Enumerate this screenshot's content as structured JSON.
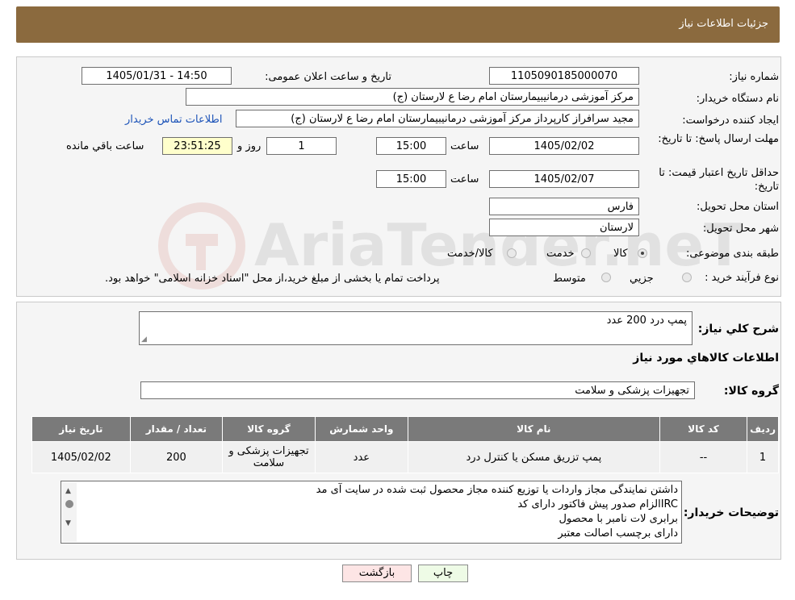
{
  "header": {
    "title": "جزئیات اطلاعات نیاز"
  },
  "labels": {
    "need_number": "شماره نیاز:",
    "announce_datetime": "تاریخ و ساعت اعلان عمومی:",
    "buyer_org": "نام دستگاه خریدار:",
    "creator": "ایجاد کننده درخواست:",
    "reply_deadline": "مهلت ارسال پاسخ: تا تاریخ:",
    "time": "ساعت",
    "day_and": "روز و",
    "remaining": "ساعت باقي مانده",
    "price_validity": "حداقل تاریخ اعتبار قیمت: تا تاریخ:",
    "province": "استان محل تحویل:",
    "city": "شهر محل تحویل:",
    "category": "طبقه بندی موضوعی:",
    "process_type": "نوع فرآیند خرید :",
    "need_desc": "شرح کلي نیاز:",
    "goods_info": "اطلاعات کالاهاي مورد نیاز",
    "goods_group": "گروه کالا:",
    "buyer_notes": "توضیحات خریدار:"
  },
  "values": {
    "need_number": "1105090185000070",
    "announce_datetime": "1405/01/31 - 14:50",
    "buyer_org": "مرکز آموزشی درمانیبیمارستان امام رضا  ع  لارستان (ج)",
    "creator": "مجید سرافراز کارپرداز  مرکز آموزشی درمانیبیمارستان امام رضا  ع  لارستان (ج)",
    "contact_link": "اطلاعات تماس خریدار",
    "reply_date": "1405/02/02",
    "reply_time": "15:00",
    "reply_days": "1",
    "countdown": "23:51:25",
    "validity_date": "1405/02/07",
    "validity_time": "15:00",
    "province": "فارس",
    "city": "لارستان",
    "need_desc": "پمپ درد 200 عدد",
    "goods_group": "تجهیزات پزشکی و سلامت"
  },
  "category_options": [
    "کالا",
    "خدمت",
    "کالا/خدمت"
  ],
  "process_options": [
    "جزیي",
    "متوسط"
  ],
  "process_note": "پرداخت تمام یا بخشی از مبلغ خرید،از محل \"اسناد خزانه اسلامی\" خواهد بود.",
  "watermark_text": "AriaTender.neT",
  "table": {
    "headers": [
      "ردیف",
      "کد کالا",
      "نام کالا",
      "واحد شمارش",
      "گروه کالا",
      "تعداد / مقدار",
      "تاریخ نیاز"
    ],
    "rows": [
      [
        "1",
        "--",
        "پمپ تزریق مسکن یا کنترل درد",
        "عدد",
        "تجهیزات پزشکی و سلامت",
        "200",
        "1405/02/02"
      ]
    ]
  },
  "buyer_notes_lines": [
    "داشتن نمایندگی مجاز واردات یا توزیع کننده مجاز محصول ثبت شده در سایت آی مد",
    "IRCالزام صدور پیش فاکتور دارای کد",
    "برابری لات نامبر با محصول",
    "دارای برچسب اصالت معتبر"
  ],
  "buttons": {
    "print": "چاپ",
    "back": "بازگشت"
  },
  "colors": {
    "header_bg": "#8b6a3e",
    "panel_bg": "#f5f5f5",
    "table_header_bg": "#7a7a7a",
    "link": "#1c53b8",
    "countdown_bg": "#ffffcc",
    "print_btn_bg": "#eefbe6",
    "back_btn_bg": "#fde5e5"
  }
}
